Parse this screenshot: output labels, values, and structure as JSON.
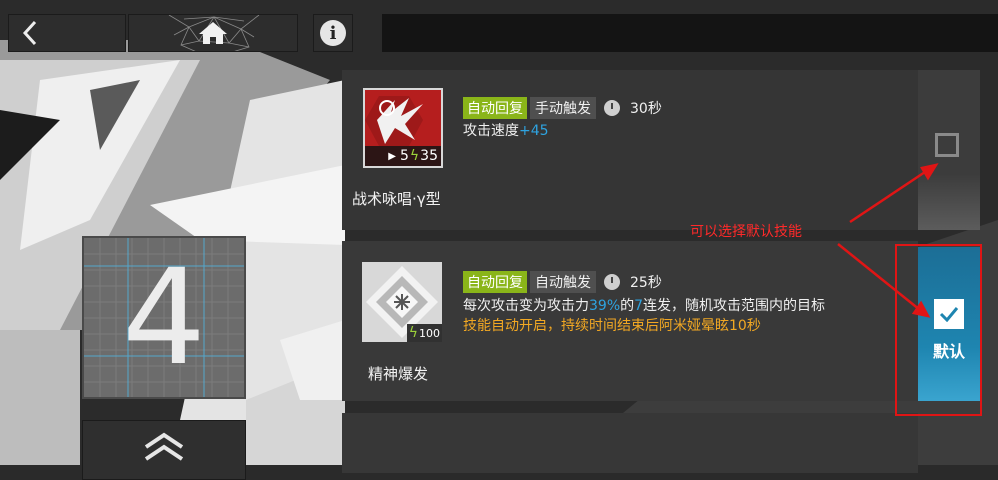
{
  "nav": {
    "back_icon": "chevron-left-icon",
    "home_icon": "home-icon",
    "info_icon": "info-icon",
    "info_glyph": "i"
  },
  "level": {
    "value": "4"
  },
  "skills": [
    {
      "name": "战术咏唱·γ型",
      "recovery": "自动回复",
      "trigger": "手动触发",
      "duration": "30秒",
      "initial_sp": "5",
      "sp_cost": "35",
      "desc_prefix": "攻击速度",
      "desc_value": "+45",
      "checked": false
    },
    {
      "name": "精神爆发",
      "recovery": "自动回复",
      "trigger": "自动触发",
      "duration": "25秒",
      "sp_cost": "100",
      "desc_line1_a": "每次攻击变为攻击力",
      "desc_line1_b": "39%",
      "desc_line1_c": "的",
      "desc_line1_d": "7",
      "desc_line1_e": "连发，随机攻击范围内的目标",
      "desc_line2": "技能自动开启，持续时间结束后阿米娅晕眩10秒",
      "checked": true,
      "default_label": "默认"
    }
  ],
  "annotation": {
    "text": "可以选择默认技能"
  },
  "colors": {
    "green_tag": "#8ab519",
    "blue_highlight": "#2ea3e0",
    "orange_text": "#f2a823",
    "selected_blue": "#1e85b0",
    "annotation_red": "#e01515"
  }
}
